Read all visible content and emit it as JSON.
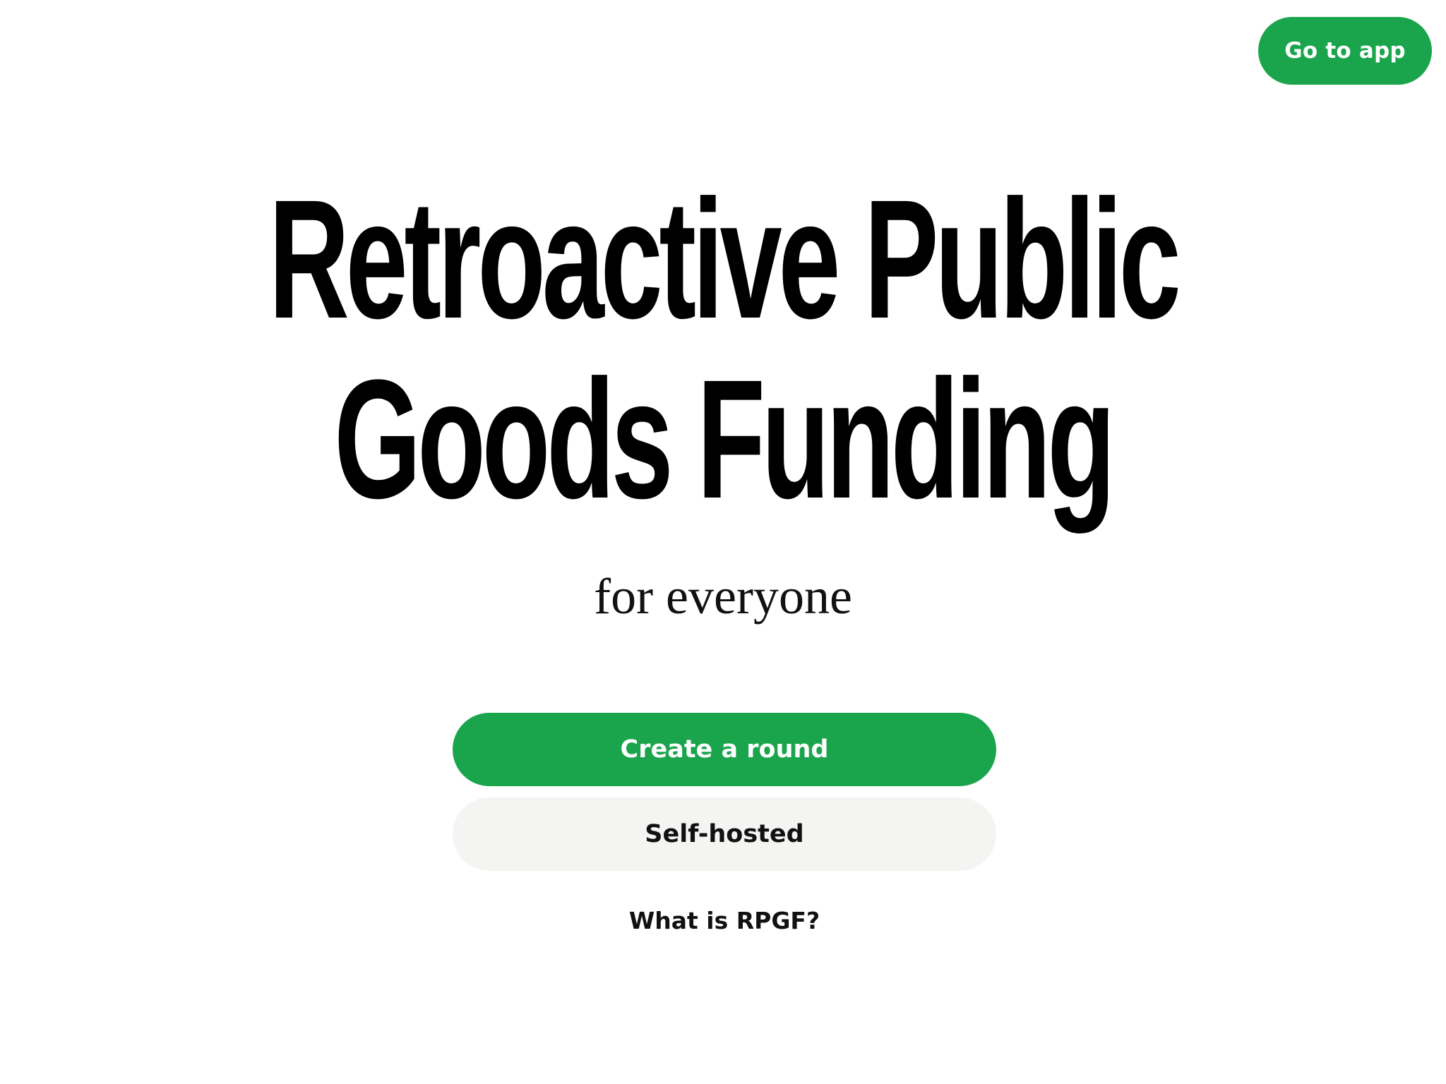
{
  "header": {
    "go_to_app_label": "Go to app"
  },
  "hero": {
    "title_line_1": "Retroactive Public",
    "title_line_2": "Goods Funding",
    "subtitle": "for everyone"
  },
  "actions": {
    "create_round_label": "Create a round",
    "self_hosted_label": "Self-hosted",
    "what_is_label": "What is RPGF?"
  },
  "colors": {
    "accent": "#1aa54d",
    "secondary_button": "#f4f4f2",
    "text": "#111111",
    "background": "#ffffff"
  }
}
